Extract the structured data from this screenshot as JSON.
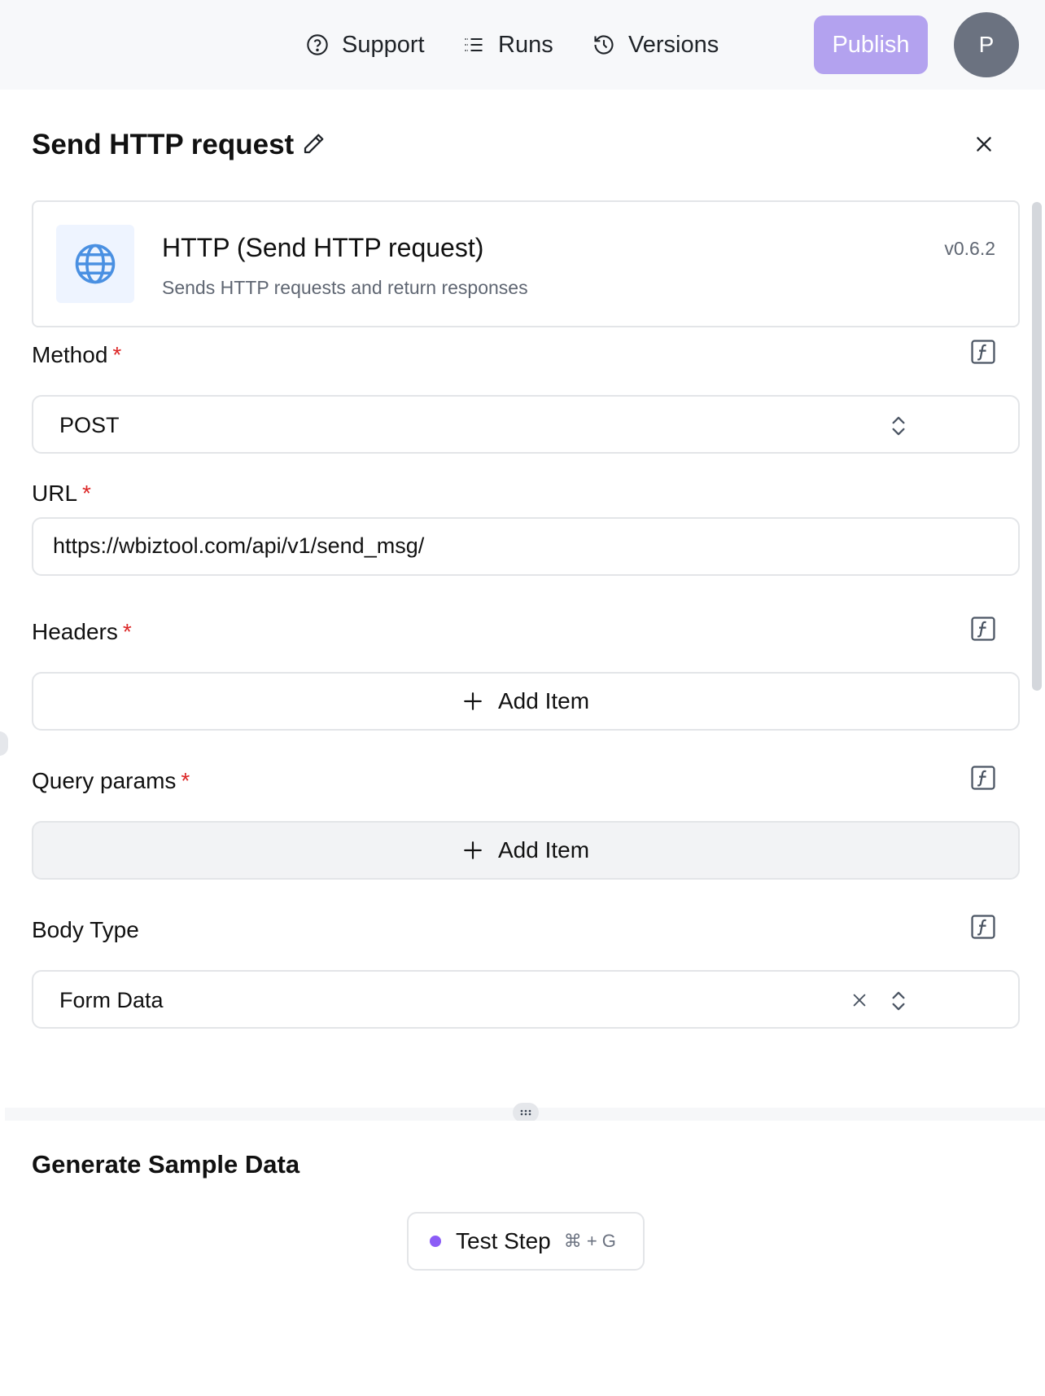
{
  "header": {
    "support_label": "Support",
    "runs_label": "Runs",
    "versions_label": "Versions",
    "publish_label": "Publish",
    "avatar_initial": "P"
  },
  "panel": {
    "title": "Send HTTP request",
    "piece": {
      "name": "HTTP (Send HTTP request)",
      "description": "Sends HTTP requests and return responses",
      "version": "v0.6.2"
    },
    "fields": {
      "method": {
        "label": "Method",
        "required_mark": "*",
        "value": "POST"
      },
      "url": {
        "label": "URL",
        "required_mark": "*",
        "value": "https://wbiztool.com/api/v1/send_msg/"
      },
      "headers": {
        "label": "Headers",
        "required_mark": "*",
        "add_label": "Add Item"
      },
      "query_params": {
        "label": "Query params",
        "required_mark": "*",
        "add_label": "Add Item"
      },
      "body_type": {
        "label": "Body Type",
        "value": "Form Data"
      }
    }
  },
  "sample": {
    "title": "Generate Sample Data",
    "test_label": "Test Step",
    "shortcut": "⌘ + G"
  },
  "colors": {
    "accent": "#8b5cf6",
    "publish_bg": "#b3a2ef",
    "required": "#dc2626",
    "globe": "#4a90e2"
  }
}
